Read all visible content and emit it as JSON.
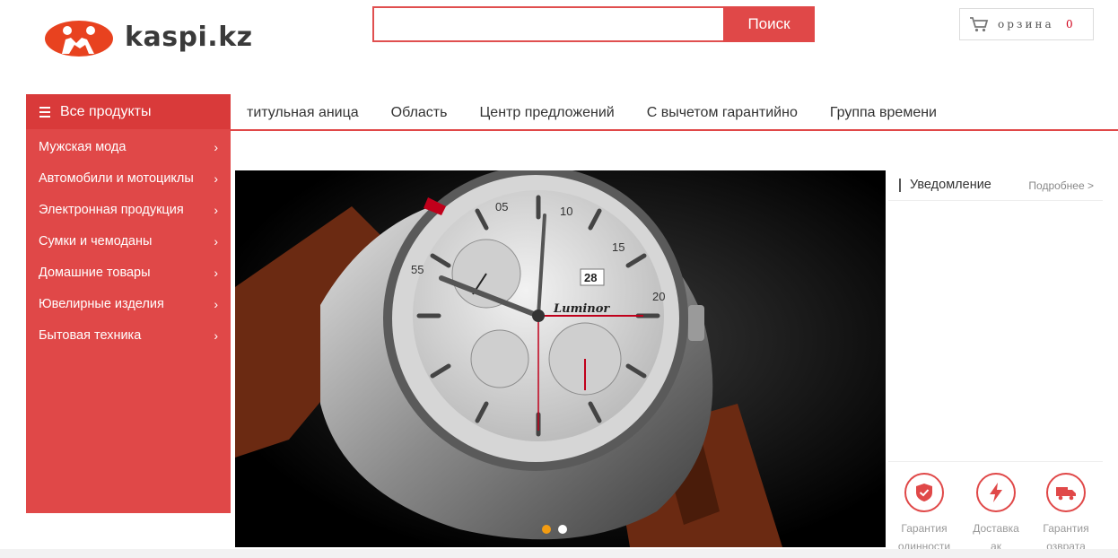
{
  "header": {
    "logo_text": "kaspi.kz",
    "search": {
      "placeholder": "",
      "value": "",
      "button_label": "Поиск"
    },
    "cart": {
      "label": "орзина",
      "count": "0"
    }
  },
  "nav": {
    "all_products_label": "Все продукты",
    "links": [
      "титульная аница",
      "Область",
      "Центр предложений",
      "С вычетом гарантийно",
      "Группа времени"
    ]
  },
  "categories": [
    "Мужская мода",
    "Автомобили и мотоциклы",
    "Электронная продукция",
    "Сумки и чемоданы",
    "Домашние товары",
    "Ювелирные изделия",
    "Бытовая техника"
  ],
  "category_arrow": "›",
  "banner": {
    "slide_count": 2,
    "active_slide": 1,
    "dial_numbers": [
      "05",
      "10",
      "15",
      "20",
      "55"
    ],
    "brand_text": "Luminor",
    "date_window": "28"
  },
  "notice": {
    "title": "Уведомление",
    "more_label": "Подробнее >"
  },
  "services": [
    {
      "icon": "shield-check-icon",
      "label_line1": "Гарантия",
      "label_line2": "одинности"
    },
    {
      "icon": "lightning-icon",
      "label_line1": "Доставка",
      "label_line2": "ак"
    },
    {
      "icon": "truck-icon",
      "label_line1": "Гарантия",
      "label_line2": "озврата"
    }
  ],
  "colors": {
    "accent": "#e04848",
    "accent_dark": "#d93a3a",
    "active_dot": "#f39c12",
    "cart_count": "#d0021b"
  }
}
